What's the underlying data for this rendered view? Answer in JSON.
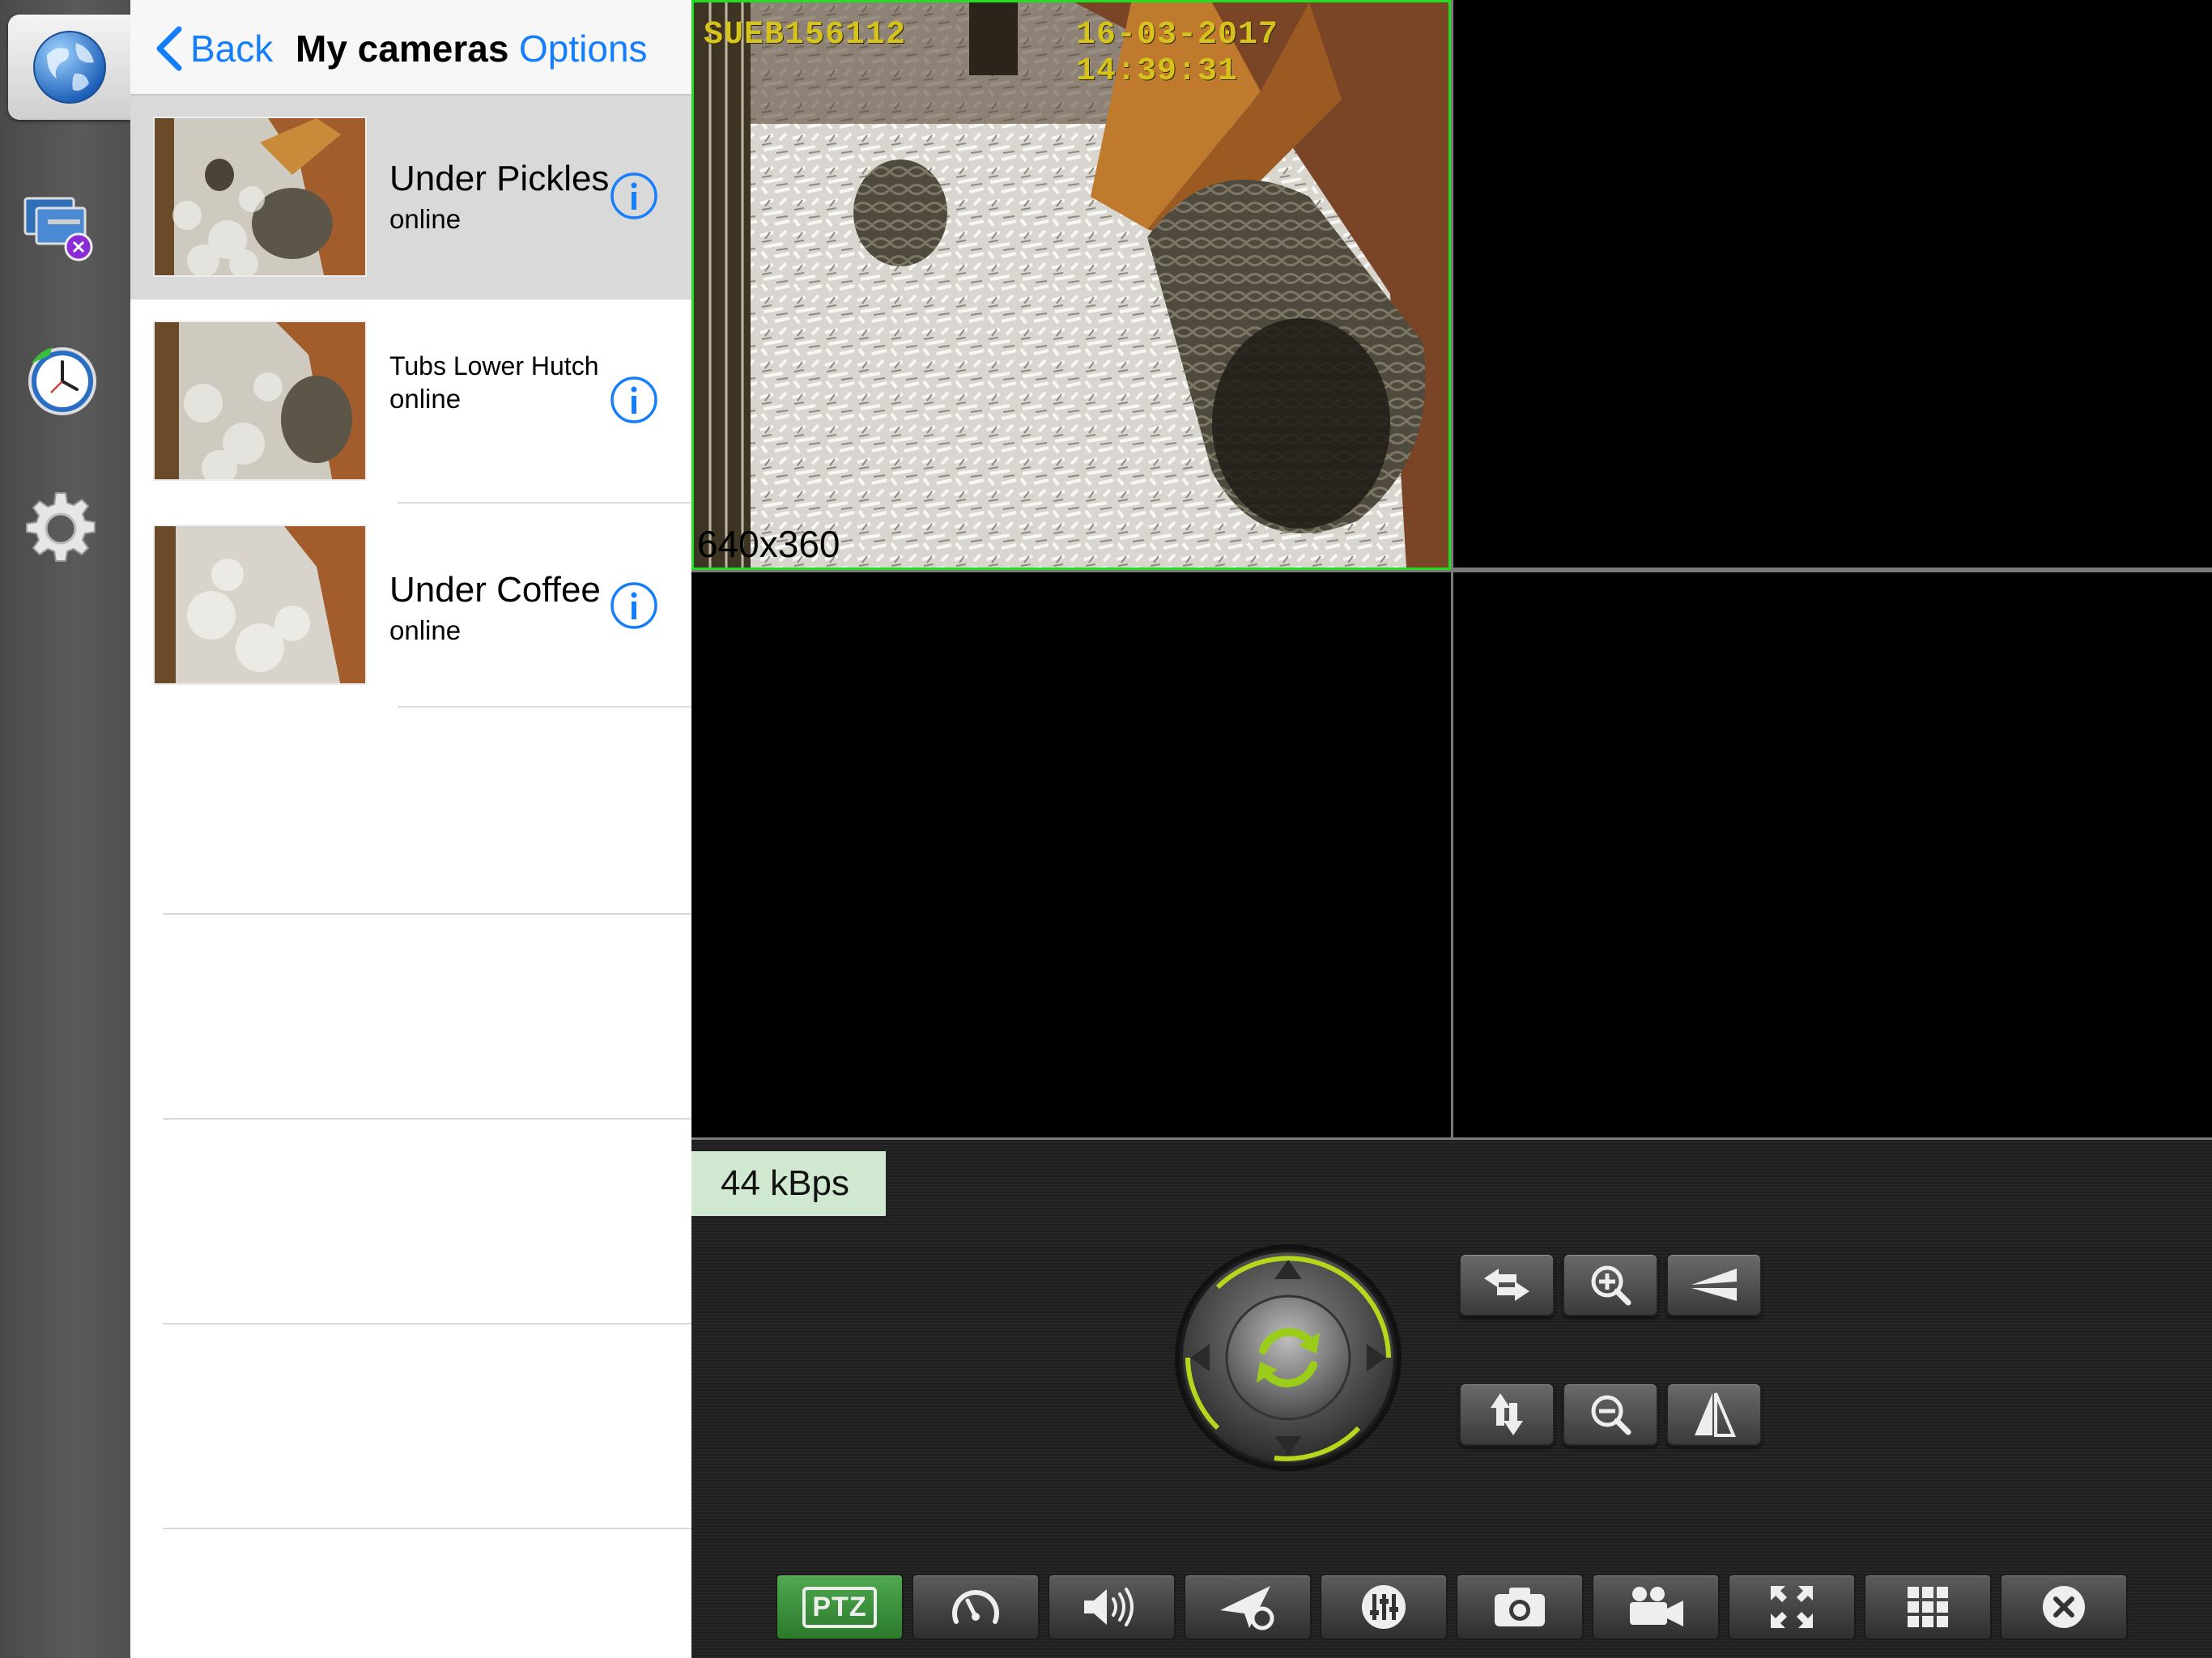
{
  "nav": {
    "back_label": "Back",
    "title": "My cameras",
    "options_label": "Options"
  },
  "rail": {
    "items": [
      {
        "name": "globe-icon",
        "active": true
      },
      {
        "name": "monitors-icon",
        "active": false
      },
      {
        "name": "clock-icon",
        "active": false
      },
      {
        "name": "gear-icon",
        "active": false
      }
    ]
  },
  "cameras": [
    {
      "name": "Under Pickles",
      "status": "online",
      "selected": true
    },
    {
      "name": "Tubs Lower Hutch",
      "status": "online",
      "selected": false
    },
    {
      "name": "Under Coffee",
      "status": "online",
      "selected": false
    }
  ],
  "video": {
    "tile1": {
      "camera_id": "SUEB156112",
      "timestamp": "16-03-2017 14:39:31",
      "resolution": "640x360"
    }
  },
  "speed": "44 kBps",
  "ptz_buttons": [
    "swap-horizontal-icon",
    "zoom-in-icon",
    "flip-horizontal-icon",
    "swap-vertical-icon",
    "zoom-out-icon",
    "mirror-icon"
  ],
  "toolbar": {
    "ptz_label": "PTZ",
    "items": [
      "ptz",
      "speedometer",
      "speaker",
      "send-settings",
      "equalizer",
      "camera",
      "video-camera",
      "fullscreen",
      "grid",
      "close"
    ]
  },
  "colors": {
    "accent_blue": "#157efb",
    "active_tile_border": "#22dd22",
    "speed_badge_bg": "#cfe8cf",
    "osd_text": "#d6c21c"
  }
}
